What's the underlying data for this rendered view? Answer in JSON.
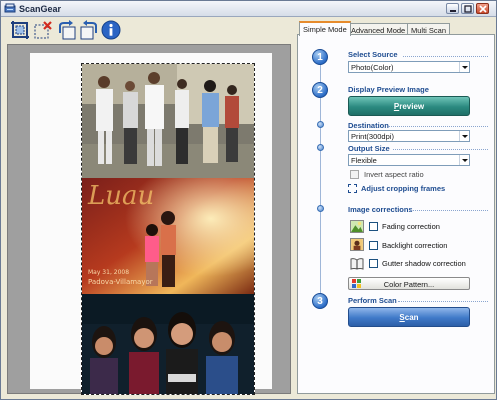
{
  "window": {
    "title": "ScanGear"
  },
  "tabs": [
    "Simple Mode",
    "Advanced Mode",
    "Multi Scan"
  ],
  "steps": [
    {
      "number": "1",
      "title": "Select Source",
      "select_value": "Photo(Color)"
    },
    {
      "number": "2",
      "title": "Display Preview Image",
      "button_accel": "P",
      "button_rest": "review"
    },
    {
      "number": "3",
      "title": "Perform Scan",
      "button_accel": "S",
      "button_rest": "can"
    }
  ],
  "destination": {
    "title": "Destination",
    "value": "Print(300dpi)"
  },
  "output_size": {
    "title": "Output Size",
    "value": "Flexible"
  },
  "invert_aspect_ratio": {
    "label": "Invert aspect ratio",
    "checked": false,
    "enabled": false
  },
  "adjust_cropping": {
    "label": "Adjust cropping frames"
  },
  "image_corrections": {
    "title": "Image corrections",
    "items": [
      {
        "label": "Fading correction",
        "checked": false,
        "icon": "fading-thumbnail-icon"
      },
      {
        "label": "Backlight correction",
        "checked": false,
        "icon": "backlight-thumbnail-icon"
      },
      {
        "label": "Gutter shadow correction",
        "checked": false,
        "icon": "book-gutter-icon"
      }
    ],
    "color_pattern_label": "Color Pattern..."
  },
  "toolbar": [
    "auto-crop-icon",
    "delete-crop-icon",
    "rotate-left-icon",
    "rotate-right-icon",
    "info-icon"
  ],
  "colors": {
    "accent": "#1f4d91",
    "preview_button": "#2b8a80",
    "scan_button": "#3f79c8",
    "tab_highlight": "#e68b2c"
  },
  "preview_photo_text": {
    "title_script": "Luau",
    "line1": "May 31, 2008",
    "line2": "Padova-Villamayor"
  }
}
